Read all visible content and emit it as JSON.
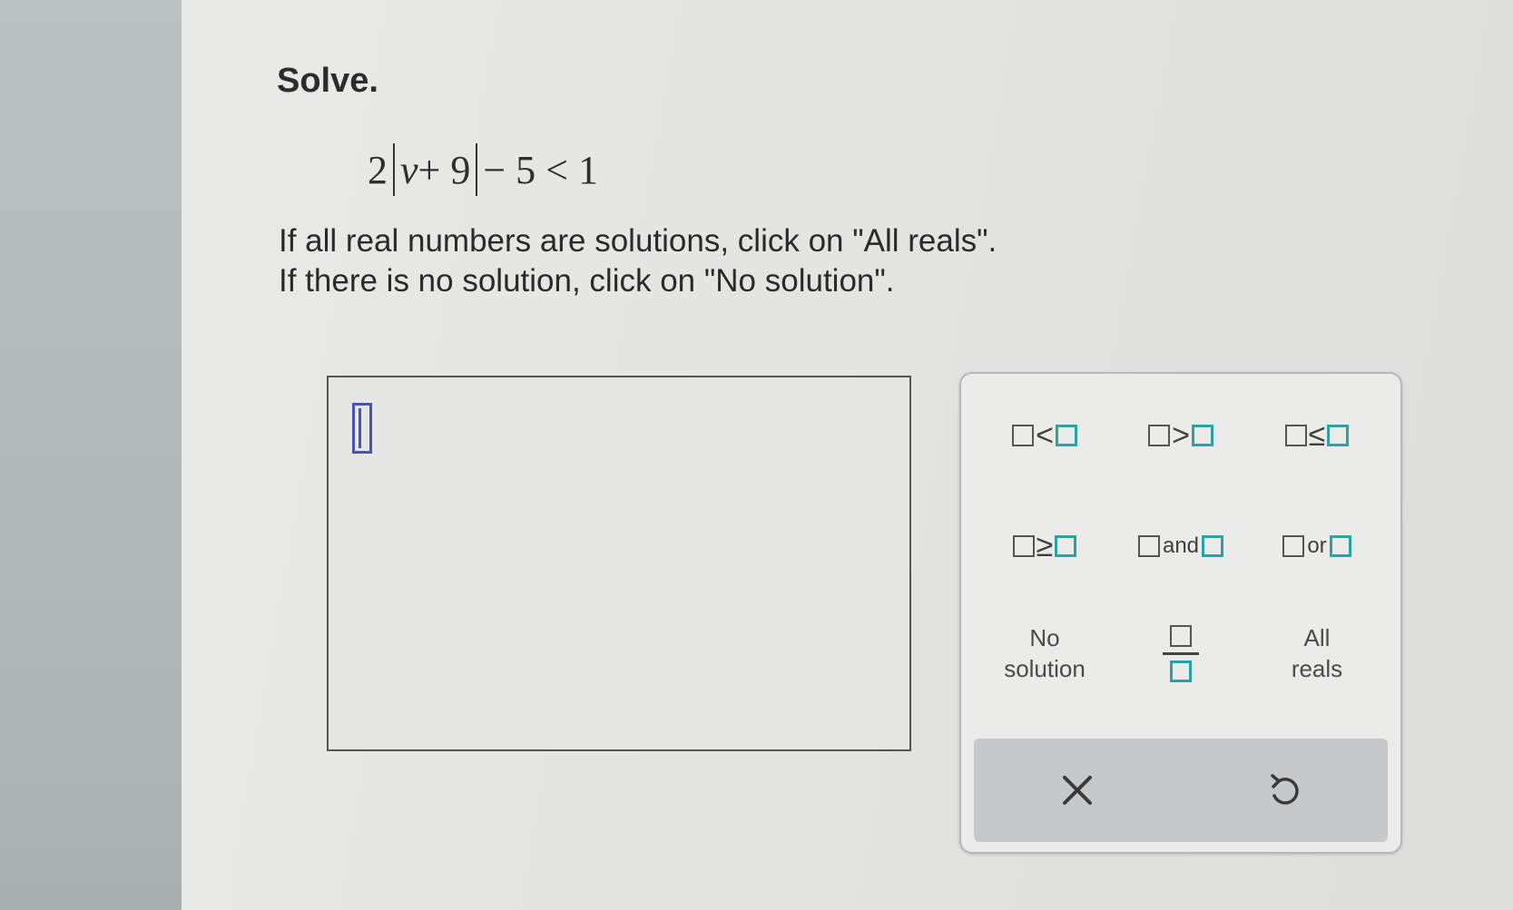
{
  "question": {
    "prompt": "Solve.",
    "equation": {
      "coefficient": "2",
      "abs_inner_var": "v",
      "abs_inner_rest": "+ 9",
      "after_abs": "− 5 < 1"
    },
    "instruction_1": "If all real numbers are solutions, click on \"All reals\".",
    "instruction_2": "If there is no solution, click on \"No solution\"."
  },
  "answer": {
    "value": ""
  },
  "keypad": {
    "row1": [
      {
        "name": "less-than",
        "op": "<"
      },
      {
        "name": "greater-than",
        "op": ">"
      },
      {
        "name": "less-equal",
        "op": "≤"
      }
    ],
    "row2": [
      {
        "name": "greater-equal",
        "op": "≥"
      },
      {
        "name": "and",
        "op": "and"
      },
      {
        "name": "or",
        "op": "or"
      }
    ],
    "no_solution_line1": "No",
    "no_solution_line2": "solution",
    "all_reals_line1": "All",
    "all_reals_line2": "reals",
    "clear_icon": "x-icon",
    "undo_icon": "undo-icon"
  },
  "colors": {
    "accent_teal": "#2aa3a6",
    "cursor_blue": "#4a53b5"
  }
}
